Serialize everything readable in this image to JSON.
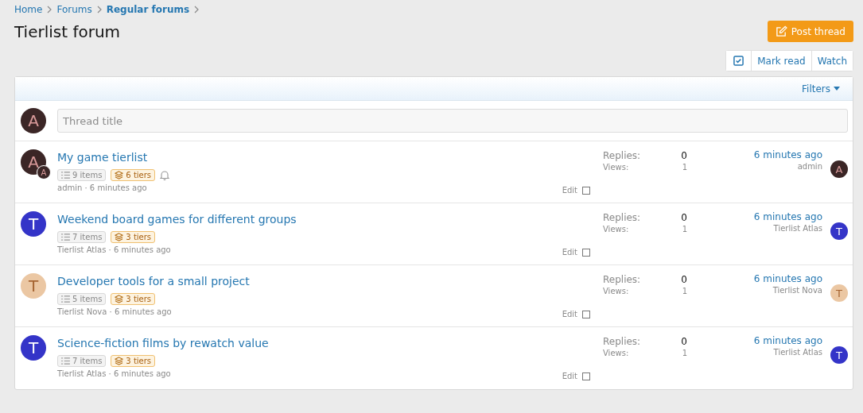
{
  "breadcrumb": [
    {
      "label": "Home",
      "current": false
    },
    {
      "label": "Forums",
      "current": false
    },
    {
      "label": "Regular forums",
      "current": true
    }
  ],
  "title": "Tierlist forum",
  "post_button": "Post thread",
  "actions": {
    "select_checked": true,
    "buttons": [
      "Mark read",
      "Watch"
    ]
  },
  "filters": "Filters",
  "quick_thread": {
    "avatar": {
      "letter": "A",
      "color": "#3b2626"
    },
    "placeholder": "Thread title"
  },
  "threads": [
    {
      "title": "My game tierlist",
      "avatar": {
        "letter": "A",
        "color": "#3b2626"
      },
      "sub_avatar": {
        "letter": "A",
        "color": "#3b2626"
      },
      "items": "9 items",
      "tiers": "6 tiers",
      "watched": true,
      "meta": "admin · 6 minutes ago",
      "edit": "Edit",
      "checked": false,
      "replies_label": "Replies:",
      "replies": "0",
      "views_label": "Views:",
      "views": "1",
      "last_time": "6 minutes ago",
      "last_user": "admin",
      "last_avatar": {
        "letter": "A",
        "color": "#3b2626"
      }
    },
    {
      "title": "Weekend board games for different groups",
      "avatar": {
        "letter": "T",
        "color": "#3434c8"
      },
      "items": "7 items",
      "tiers": "3 tiers",
      "watched": false,
      "meta": "Tierlist Atlas · 6 minutes ago",
      "edit": "Edit",
      "checked": false,
      "replies_label": "Replies:",
      "replies": "0",
      "views_label": "Views:",
      "views": "1",
      "last_time": "6 minutes ago",
      "last_user": "Tierlist Atlas",
      "last_avatar": {
        "letter": "T",
        "color": "#3434c8"
      }
    },
    {
      "title": "Developer tools for a small project",
      "avatar": {
        "letter": "T",
        "color": "#ebc7a3"
      },
      "items": "5 items",
      "tiers": "3 tiers",
      "watched": false,
      "meta": "Tierlist Nova · 6 minutes ago",
      "edit": "Edit",
      "checked": false,
      "replies_label": "Replies:",
      "replies": "0",
      "views_label": "Views:",
      "views": "1",
      "last_time": "6 minutes ago",
      "last_user": "Tierlist Nova",
      "last_avatar": {
        "letter": "T",
        "color": "#ebc7a3"
      }
    },
    {
      "title": "Science-fiction films by rewatch value",
      "avatar": {
        "letter": "T",
        "color": "#3434c8"
      },
      "items": "7 items",
      "tiers": "3 tiers",
      "watched": false,
      "meta": "Tierlist Atlas · 6 minutes ago",
      "edit": "Edit",
      "checked": false,
      "replies_label": "Replies:",
      "replies": "0",
      "views_label": "Views:",
      "views": "1",
      "last_time": "6 minutes ago",
      "last_user": "Tierlist Atlas",
      "last_avatar": {
        "letter": "T",
        "color": "#3434c8"
      }
    }
  ]
}
